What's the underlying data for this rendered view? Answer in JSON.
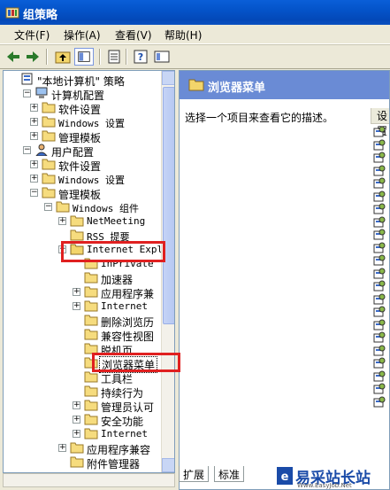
{
  "window": {
    "title": "组策略"
  },
  "menu": [
    "文件(F)",
    "操作(A)",
    "查看(V)",
    "帮助(H)"
  ],
  "tree": [
    {
      "label": "\"本地计算机\" 策略",
      "icon": "computer-policy-icon"
    },
    {
      "label": "计算机配置",
      "icon": "computer-icon",
      "exp": "−"
    },
    {
      "label": "软件设置",
      "icon": "folder-icon",
      "exp": "+"
    },
    {
      "label": "Windows 设置",
      "icon": "folder-icon",
      "exp": "+"
    },
    {
      "label": "管理模板",
      "icon": "folder-icon",
      "exp": "+"
    },
    {
      "label": "用户配置",
      "icon": "user-icon",
      "exp": "−"
    },
    {
      "label": "软件设置",
      "icon": "folder-icon",
      "exp": "+"
    },
    {
      "label": "Windows 设置",
      "icon": "folder-icon",
      "exp": "+"
    },
    {
      "label": "管理模板",
      "icon": "folder-icon",
      "exp": "−"
    },
    {
      "label": "Windows 组件",
      "icon": "folder-icon",
      "exp": "−"
    },
    {
      "label": "NetMeeting",
      "icon": "folder-icon",
      "exp": "+"
    },
    {
      "label": "RSS 提要",
      "icon": "folder-icon"
    },
    {
      "label": "Internet Expl",
      "icon": "folder-open-icon",
      "exp": "−"
    },
    {
      "label": "InPrivate",
      "icon": "folder-icon"
    },
    {
      "label": "加速器",
      "icon": "folder-icon"
    },
    {
      "label": "应用程序兼",
      "icon": "folder-icon",
      "exp": "+"
    },
    {
      "label": "Internet",
      "icon": "folder-icon",
      "exp": "+"
    },
    {
      "label": "删除浏览历",
      "icon": "folder-icon"
    },
    {
      "label": "兼容性视图",
      "icon": "folder-icon"
    },
    {
      "label": "脱机页",
      "icon": "folder-icon"
    },
    {
      "label": "浏览器菜单",
      "icon": "folder-icon"
    },
    {
      "label": "工具栏",
      "icon": "folder-icon"
    },
    {
      "label": "持续行为",
      "icon": "folder-icon"
    },
    {
      "label": "管理员认可",
      "icon": "folder-icon",
      "exp": "+"
    },
    {
      "label": "安全功能",
      "icon": "folder-icon",
      "exp": "+"
    },
    {
      "label": "Internet",
      "icon": "folder-icon",
      "exp": "+"
    },
    {
      "label": "应用程序兼容",
      "icon": "folder-icon",
      "exp": "+"
    },
    {
      "label": "附件管理器",
      "icon": "folder-icon"
    }
  ],
  "right": {
    "title": "浏览器菜单",
    "description": "选择一个项目来查看它的描述。",
    "column_header": "设置"
  },
  "tabs": {
    "extended": "扩展",
    "standard": "标准"
  },
  "watermark": {
    "text": "易采站长站",
    "sub": "Www.EasyJob.Net"
  },
  "colors": {
    "title_bar": "#0453c9",
    "header": "#6a8bd5",
    "highlight": "#e02020"
  }
}
